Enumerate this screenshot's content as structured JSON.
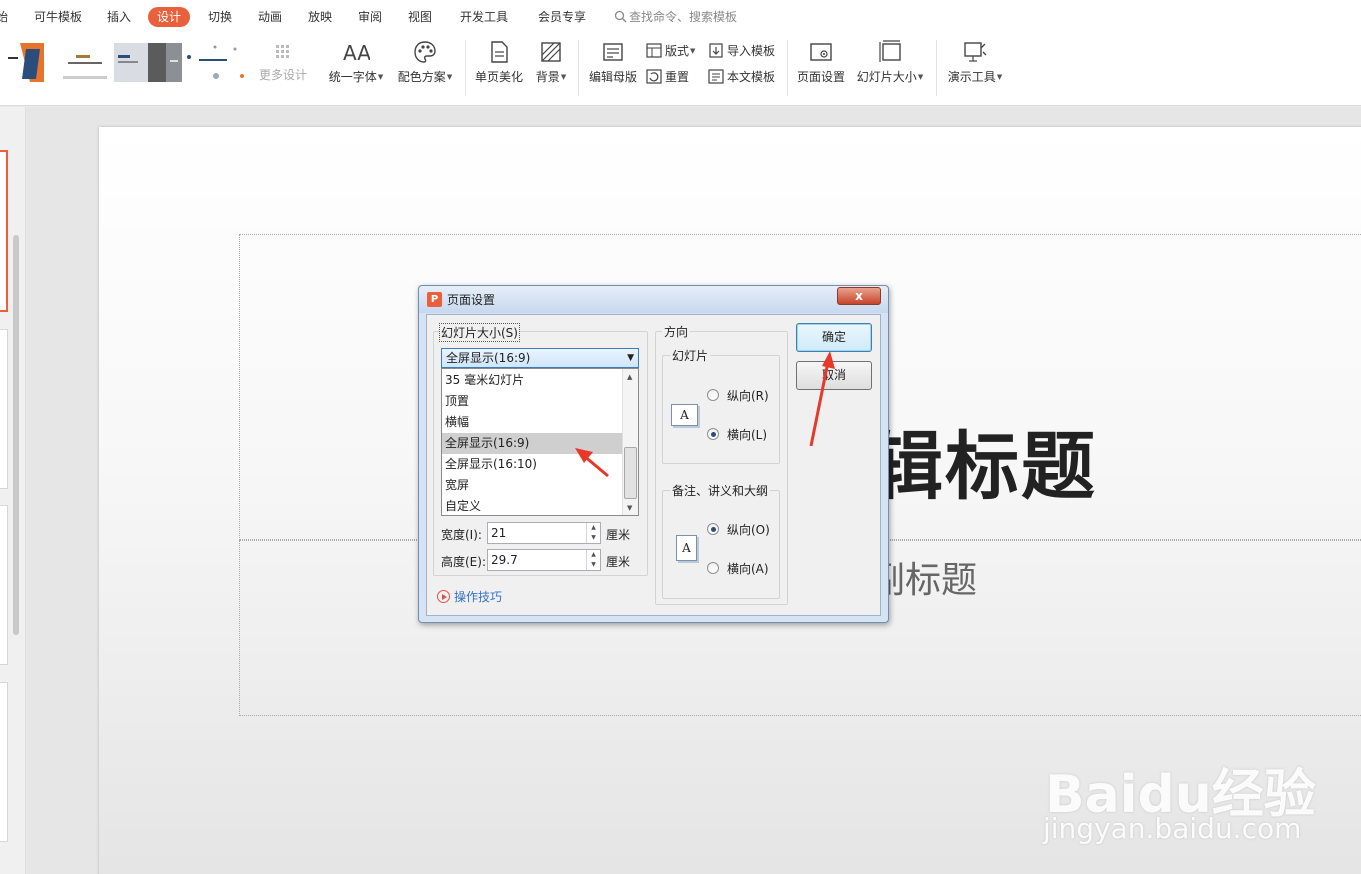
{
  "menu": {
    "tabs": [
      "始",
      "可牛模板",
      "插入",
      "设计",
      "切换",
      "动画",
      "放映",
      "审阅",
      "视图",
      "开发工具",
      "会员专享"
    ],
    "active_tab": "设计",
    "search_placeholder": "查找命令、搜索模板"
  },
  "ribbon": {
    "more_design": "更多设计",
    "unify_font": "统一字体",
    "color_scheme": "配色方案",
    "single_beautify": "单页美化",
    "background": "背景",
    "edit_master": "编辑母版",
    "layout": "版式",
    "reset": "重置",
    "import_template": "导入模板",
    "text_template": "本文模板",
    "page_setup": "页面设置",
    "slide_size": "幻灯片大小",
    "presentation_tools": "演示工具"
  },
  "slide": {
    "title_partial": "辑标题",
    "subtitle_partial": "副标题"
  },
  "dialog": {
    "title": "页面设置",
    "close": "x",
    "slide_size_group": "幻灯片大小(S)",
    "selected_size": "全屏显示(16:9)",
    "size_options": [
      "35 毫米幻灯片",
      "顶置",
      "横幅",
      "全屏显示(16:9)",
      "全屏显示(16:10)",
      "宽屏",
      "自定义"
    ],
    "hovered_option": "全屏显示(16:9)",
    "width_label": "宽度(I):",
    "width_value": "21",
    "height_label": "高度(E):",
    "height_value": "29.7",
    "unit": "厘米",
    "tips": "操作技巧",
    "orientation_group": "方向",
    "slides_group": "幻灯片",
    "slides_portrait": "纵向(R)",
    "slides_landscape": "横向(L)",
    "slides_orientation": "landscape",
    "notes_group": "备注、讲义和大纲",
    "notes_portrait": "纵向(O)",
    "notes_landscape": "横向(A)",
    "notes_orientation": "portrait",
    "ok": "确定",
    "cancel": "取消"
  },
  "watermark": {
    "logo": "Baidu经验",
    "url": "jingyan.baidu.com"
  },
  "colors": {
    "accent": "#e8613c",
    "annotation_arrow": "#e8382a",
    "dialog_frame": "#d5e3f4"
  }
}
